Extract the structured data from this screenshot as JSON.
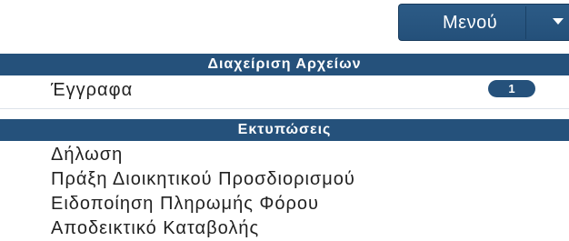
{
  "menu": {
    "label": "Μενού",
    "caret_icon": "caret-down-icon"
  },
  "file_management": {
    "title": "Διαχείριση Αρχείων",
    "items": [
      {
        "label": "Έγγραφα",
        "badge": "1"
      }
    ]
  },
  "prints": {
    "title": "Εκτυπώσεις",
    "items": [
      {
        "label": "Δήλωση"
      },
      {
        "label": "Πράξη Διοικητικού Προσδιορισμού"
      },
      {
        "label": "Ειδοποίηση Πληρωμής Φόρου"
      },
      {
        "label": "Αποδεικτικό Καταβολής"
      }
    ]
  },
  "colors": {
    "header_bg": "#25517b",
    "header_text": "#ffffff",
    "body_text": "#222222",
    "badge_bg": "#25517b"
  }
}
